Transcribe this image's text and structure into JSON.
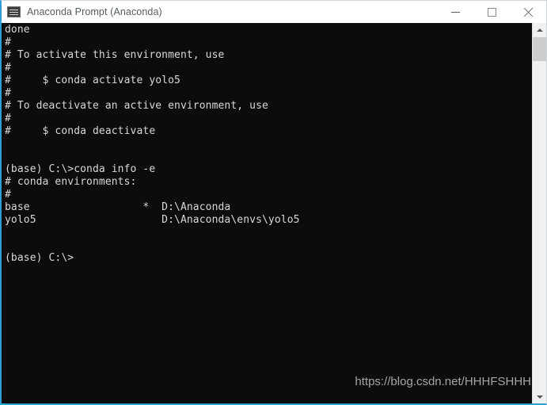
{
  "window": {
    "title": "Anaconda Prompt (Anaconda)",
    "icon": "console-icon",
    "accent_color": "#2e9fd4",
    "titlebar_bg": "#ffffff",
    "console_bg": "#0c0c0c",
    "console_fg": "#d8d8d8",
    "buttons": {
      "minimize_label": "Minimize",
      "maximize_label": "Maximize",
      "close_label": "Close"
    }
  },
  "console": {
    "prompt_prefix": "(base) C:\\>",
    "commands": [
      "conda info -e"
    ],
    "environments": {
      "header": "# conda environments:",
      "rows": [
        {
          "name": "base",
          "active": "*",
          "path": "D:\\Anaconda"
        },
        {
          "name": "yolo5",
          "active": "",
          "path": "D:\\Anaconda\\envs\\yolo5"
        }
      ]
    },
    "lines": [
      "done",
      "#",
      "# To activate this environment, use",
      "#",
      "#     $ conda activate yolo5",
      "#",
      "# To deactivate an active environment, use",
      "#",
      "#     $ conda deactivate",
      "",
      "",
      "(base) C:\\>conda info -e",
      "# conda environments:",
      "#",
      "base                  *  D:\\Anaconda",
      "yolo5                    D:\\Anaconda\\envs\\yolo5",
      "",
      "",
      "(base) C:\\>"
    ],
    "text": "done\n#\n# To activate this environment, use\n#\n#     $ conda activate yolo5\n#\n# To deactivate an active environment, use\n#\n#     $ conda deactivate\n\n\n(base) C:\\>conda info -e\n# conda environments:\n#\nbase                  *  D:\\Anaconda\nyolo5                    D:\\Anaconda\\envs\\yolo5\n\n\n(base) C:\\>"
  },
  "watermark": {
    "text": "https://blog.csdn.net/HHHFSHHH"
  },
  "scrollbar": {
    "up_arrow": "chevron-up-icon",
    "down_arrow": "chevron-down-icon"
  }
}
